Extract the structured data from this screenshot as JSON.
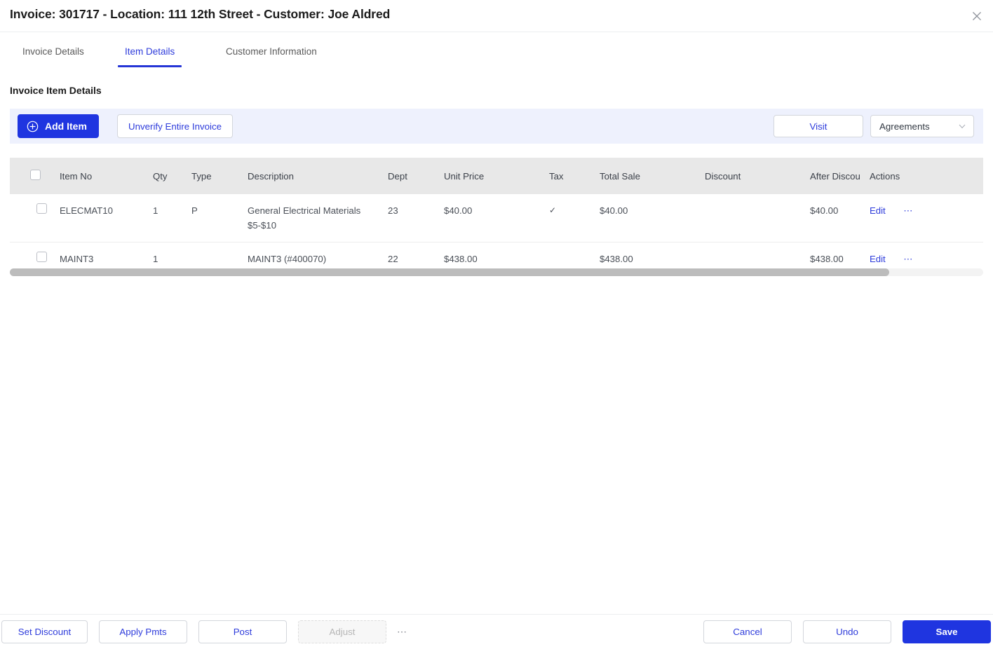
{
  "header": {
    "title": "Invoice: 301717 - Location: 111 12th Street - Customer: Joe Aldred",
    "close_icon": "close-icon"
  },
  "tabs": [
    {
      "label": "Invoice Details",
      "active": false
    },
    {
      "label": "Item Details",
      "active": true
    },
    {
      "label": "Customer Information",
      "active": false
    }
  ],
  "section": {
    "title": "Invoice Item Details"
  },
  "action_band": {
    "add_item_label": "Add Item",
    "add_item_icon": "plus-circle-icon",
    "unverify_label": "Unverify Entire Invoice",
    "visit_label": "Visit",
    "agreements_label": "Agreements",
    "agreements_chevron_icon": "chevron-down-icon"
  },
  "table": {
    "columns": [
      "",
      "Item No",
      "Qty",
      "Type",
      "Description",
      "Dept",
      "Unit Price",
      "Tax",
      "Total Sale",
      "Discount",
      "After Discou",
      "Actions"
    ],
    "rows": [
      {
        "item_no": "ELECMAT10",
        "qty": "1",
        "type": "P",
        "description": "General Electrical Materials $5-$10",
        "dept": "23",
        "unit_price": "$40.00",
        "tax": "✓",
        "total_sale": "$40.00",
        "discount": "",
        "after_discount": "$40.00",
        "edit_label": "Edit",
        "more_label": "⋯"
      },
      {
        "item_no": "MAINT3",
        "qty": "1",
        "type": "",
        "description": "MAINT3 (#400070)",
        "dept": "22",
        "unit_price": "$438.00",
        "tax": "",
        "total_sale": "$438.00",
        "discount": "",
        "after_discount": "$438.00",
        "edit_label": "Edit",
        "more_label": "⋯"
      }
    ]
  },
  "footer": {
    "set_discount_label": "Set Discount",
    "apply_pmts_label": "Apply Pmts",
    "post_label": "Post",
    "adjust_label": "Adjust",
    "more_label": "⋯",
    "cancel_label": "Cancel",
    "undo_label": "Undo",
    "save_label": "Save"
  },
  "colors": {
    "accent": "#2d3bdb",
    "primary_button": "#1f35e0",
    "band_background": "#eef1fd",
    "table_header": "#e8e8e8"
  }
}
